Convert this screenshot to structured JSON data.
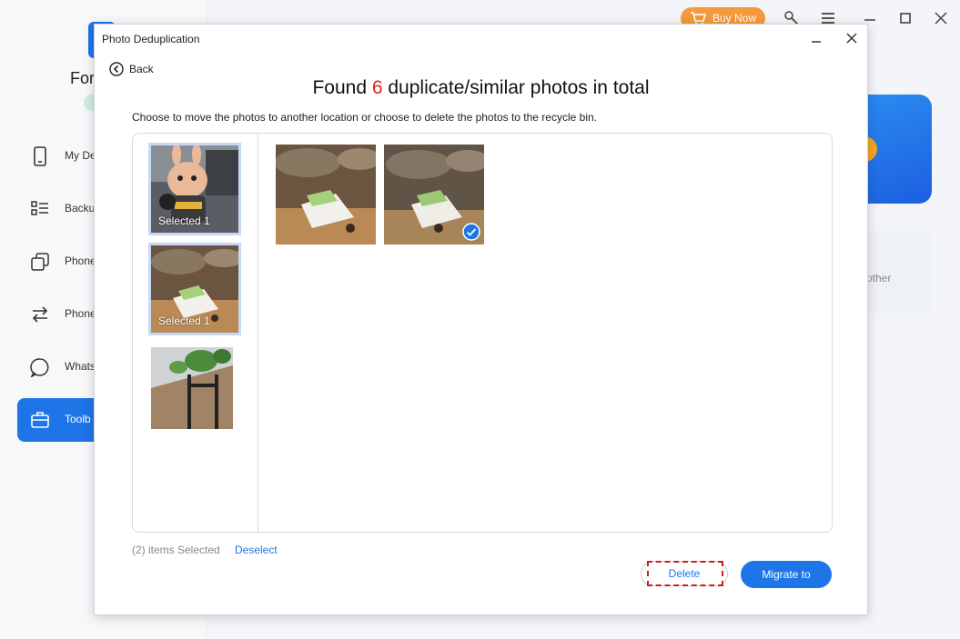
{
  "app": {
    "title": "For",
    "buy_now": "Buy Now",
    "nav": [
      {
        "label": "My De",
        "icon": "phone-icon"
      },
      {
        "label": "Backu",
        "icon": "backup-list-icon"
      },
      {
        "label": "Phone",
        "icon": "copy-icon"
      },
      {
        "label": "Phone",
        "icon": "transfer-icon"
      },
      {
        "label": "Whats",
        "icon": "chat-icon"
      },
      {
        "label": "Toolb",
        "icon": "toolbox-icon",
        "active": true
      }
    ],
    "card2_text": "other",
    "accent": "#1d75e8"
  },
  "dialog": {
    "title": "Photo Deduplication",
    "back_label": "Back",
    "headline_prefix": "Found ",
    "headline_count": "6",
    "headline_suffix": " duplicate/similar photos in total",
    "subtitle": "Choose to move the photos to another location or choose to delete the photos to the recycle bin.",
    "groups": [
      {
        "caption": "Selected 1",
        "selected": true
      },
      {
        "caption": "Selected 1",
        "selected": true
      },
      {
        "caption": "",
        "selected": false
      }
    ],
    "photos": [
      {
        "checked": false
      },
      {
        "checked": true
      }
    ],
    "selected_count_text": "(2) items Selected",
    "deselect_label": "Deselect",
    "delete_label": "Delete",
    "migrate_label": "Migrate to",
    "highlight_color": "#d21a1a",
    "count_color": "#e02020"
  }
}
